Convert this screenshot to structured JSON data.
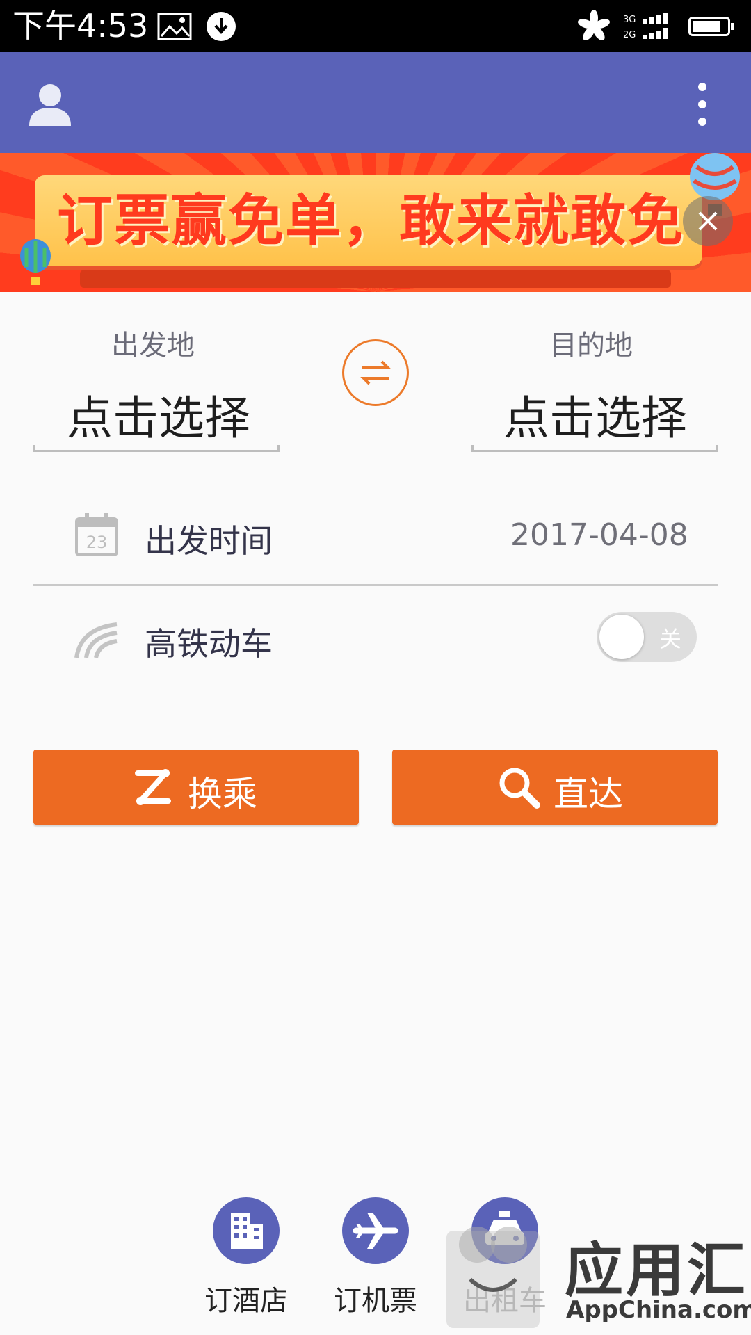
{
  "status_bar": {
    "time": "下午4:53",
    "signal_labels": [
      "3G",
      "2G"
    ]
  },
  "app_bar": {
    "avatar_icon": "user-avatar-icon",
    "menu_icon": "more-vert-icon",
    "color": "#5a62b8"
  },
  "banner": {
    "text": "订票赢免单，敢来就敢免",
    "close_icon": "close-icon"
  },
  "route": {
    "from_label": "出发地",
    "from_value": "点击选择",
    "to_label": "目的地",
    "to_value": "点击选择",
    "swap_icon": "swap-icon"
  },
  "date_row": {
    "calendar_day": "23",
    "label": "出发时间",
    "value": "2017-04-08"
  },
  "high_speed_row": {
    "label": "高铁动车",
    "toggle_state_text": "关",
    "toggle_on": false
  },
  "actions": {
    "transfer_label": "换乘",
    "direct_label": "直达",
    "color": "#ed6a22"
  },
  "bottom_nav": [
    {
      "label": "订酒店",
      "icon": "hotel-icon"
    },
    {
      "label": "订机票",
      "icon": "airplane-icon"
    },
    {
      "label": "出租车",
      "icon": "taxi-icon"
    }
  ],
  "watermark": {
    "title": "应用汇",
    "subtitle": "AppChina.com"
  }
}
